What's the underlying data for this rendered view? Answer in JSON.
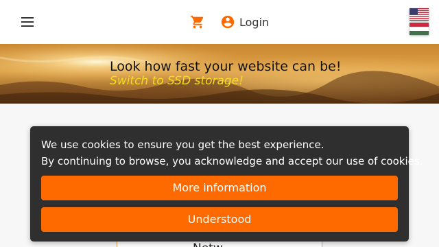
{
  "header": {
    "login_label": "Login",
    "icons": [
      "menu-icon",
      "shopping-cart-icon",
      "account-circle-icon",
      "flag-us-icon",
      "flag-hu-icon"
    ],
    "accent_color": "#ff6a00"
  },
  "banner": {
    "title": "Look how fast your website can be!",
    "subtitle": "Switch to SSD storage!",
    "subtitle_color": "#f3dd1f"
  },
  "content": {
    "plan_title": "Netw."
  },
  "cookie_notice": {
    "line1": "We use cookies to ensure you get the best experience.",
    "line2": "By continuing to browse, you acknowledge and accept our use of cookies.",
    "more_info_label": "More information",
    "accept_label": "Understood",
    "background_color": "#2f2f2f",
    "button_color": "#ff6a00"
  }
}
